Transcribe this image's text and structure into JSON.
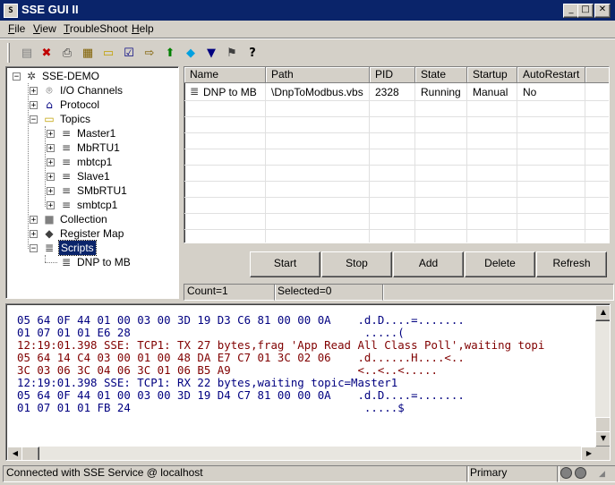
{
  "window": {
    "title": "SSE GUI II",
    "app_icon_glyph": "S",
    "controls": {
      "minimize": "_",
      "maximize": "□",
      "close": "✕"
    }
  },
  "menu": [
    {
      "label": "File",
      "accel": "F",
      "rest": "ile"
    },
    {
      "label": "View",
      "accel": "V",
      "rest": "iew"
    },
    {
      "label": "TroubleShoot",
      "accel": "T",
      "rest": "roubleShoot"
    },
    {
      "label": "Help",
      "accel": "H",
      "rest": "elp"
    }
  ],
  "toolbar": [
    {
      "name": "server-icon",
      "glyph": "▤"
    },
    {
      "name": "delete-icon",
      "glyph": "✖"
    },
    {
      "name": "printer-icon",
      "glyph": "⎙"
    },
    {
      "name": "properties-icon",
      "glyph": "▦"
    },
    {
      "name": "open-folder-icon",
      "glyph": "▭"
    },
    {
      "name": "check-icon",
      "glyph": "☑"
    },
    {
      "name": "import-icon",
      "glyph": "⇨"
    },
    {
      "name": "upload-icon",
      "glyph": "⬆"
    },
    {
      "name": "diamond-icon",
      "glyph": "◆"
    },
    {
      "name": "filter-icon",
      "glyph": "▼"
    },
    {
      "name": "wizard-icon",
      "glyph": "⚑"
    },
    {
      "name": "help-icon",
      "glyph": "?"
    }
  ],
  "tree": {
    "root": "SSE-DEMO",
    "items": [
      {
        "label": "I/O Channels",
        "icon": "satellite-icon",
        "glyph": "⌾"
      },
      {
        "label": "Protocol",
        "icon": "protocol-icon",
        "glyph": "⌂"
      },
      {
        "label": "Topics",
        "icon": "topics-icon",
        "glyph": "▭"
      },
      {
        "label": "Master1",
        "icon": "topic-icon",
        "glyph": "≡"
      },
      {
        "label": "MbRTU1",
        "icon": "topic-icon",
        "glyph": "≡"
      },
      {
        "label": "mbtcp1",
        "icon": "topic-icon",
        "glyph": "≡"
      },
      {
        "label": "Slave1",
        "icon": "topic-icon",
        "glyph": "≡"
      },
      {
        "label": "SMbRTU1",
        "icon": "topic-icon",
        "glyph": "≡"
      },
      {
        "label": "smbtcp1",
        "icon": "topic-icon",
        "glyph": "≡"
      },
      {
        "label": "Collection",
        "icon": "collection-icon",
        "glyph": "■"
      },
      {
        "label": "Register Map",
        "icon": "register-map-icon",
        "glyph": "◆"
      },
      {
        "label": "Scripts",
        "icon": "scripts-icon",
        "glyph": "≣"
      },
      {
        "label": "DNP to MB",
        "icon": "script-icon",
        "glyph": "≣"
      }
    ]
  },
  "list": {
    "columns": [
      "Name",
      "Path",
      "PID",
      "State",
      "Startup",
      "AutoRestart"
    ],
    "rows": [
      {
        "name": "DNP to MB",
        "path": "\\DnpToModbus.vbs",
        "pid": "2328",
        "state": "Running",
        "startup": "Manual",
        "autorestart": "No"
      }
    ]
  },
  "buttons": {
    "start": "Start",
    "stop": "Stop",
    "add": "Add",
    "delete": "Delete",
    "refresh": "Refresh"
  },
  "list_status": {
    "count": "Count=1",
    "selected": "Selected=0"
  },
  "log": {
    "lines": [
      {
        "text": "05 64 0F 44 01 00 03 00 3D 19 D3 C6 81 00 00 0A    .d.D....=.......",
        "color": "#000080"
      },
      {
        "text": "01 07 01 01 E6 28                                   .....(",
        "color": "#000080"
      },
      {
        "text": "12:19:01.398 SSE: TCP1: TX 27 bytes,frag 'App Read All Class Poll',waiting topi",
        "color": "#800000"
      },
      {
        "text": "05 64 14 C4 03 00 01 00 48 DA E7 C7 01 3C 02 06    .d......H....<..",
        "color": "#800000"
      },
      {
        "text": "3C 03 06 3C 04 06 3C 01 06 B5 A9                   <..<..<.....",
        "color": "#800000"
      },
      {
        "text": "12:19:01.398 SSE: TCP1: RX 22 bytes,waiting topic=Master1",
        "color": "#000080"
      },
      {
        "text": "05 64 0F 44 01 00 03 00 3D 19 D4 C7 81 00 00 0A    .d.D....=.......",
        "color": "#000080"
      },
      {
        "text": "01 07 01 01 FB 24                                   .....$",
        "color": "#000080"
      }
    ]
  },
  "statusbar": {
    "connection": "Connected with SSE Service @ localhost",
    "role": "Primary"
  }
}
